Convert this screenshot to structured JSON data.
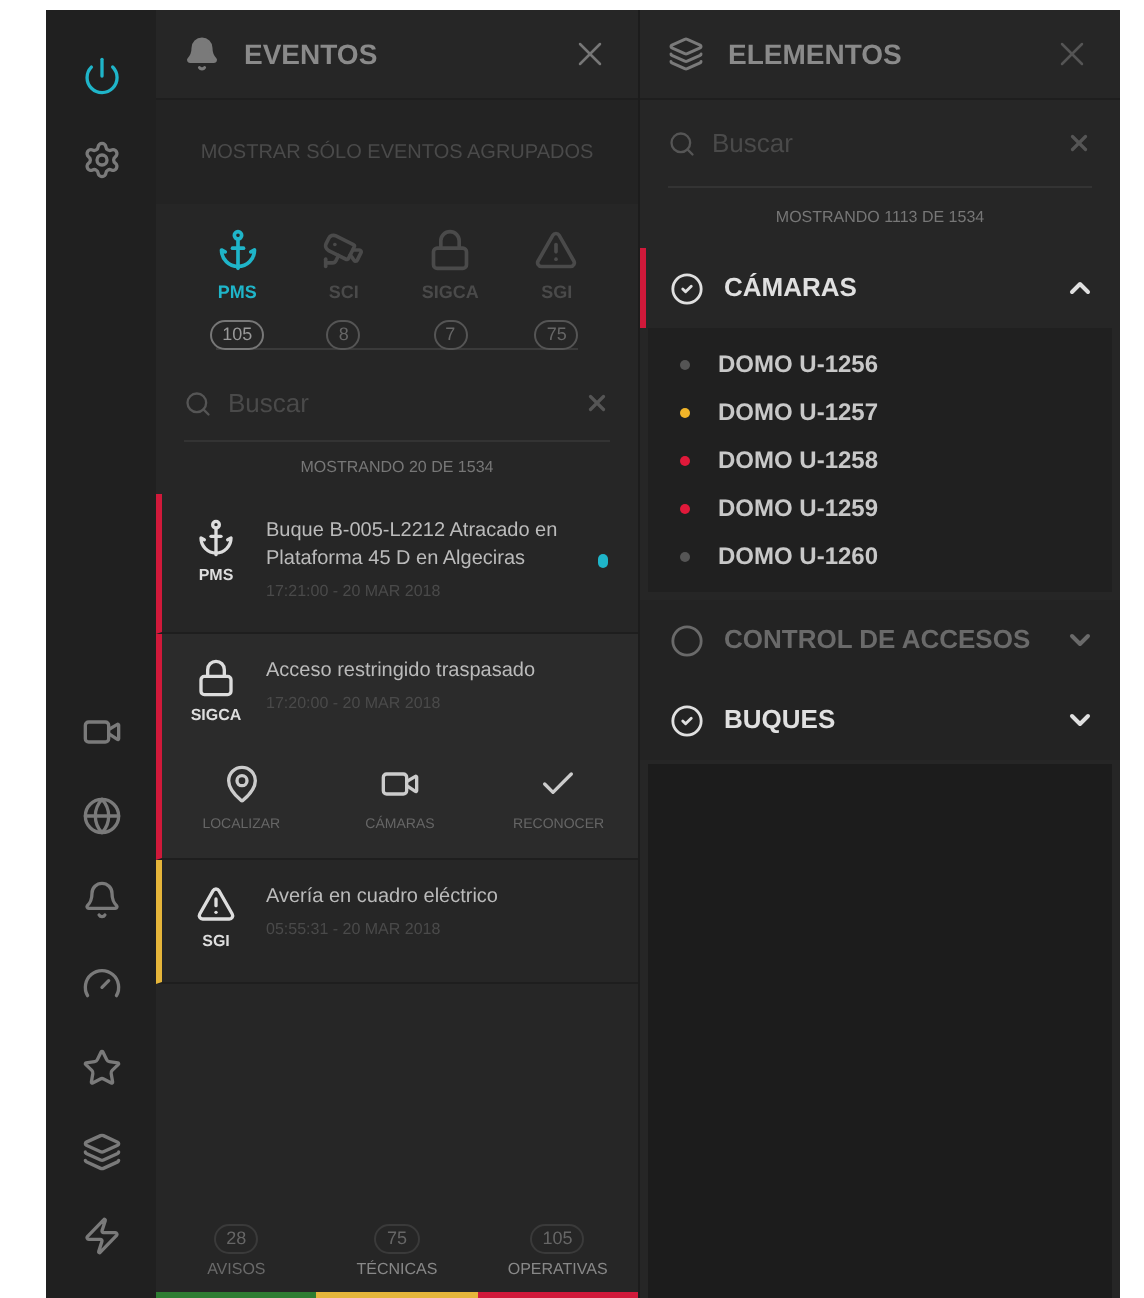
{
  "sidebar": {
    "top_items": [
      {
        "selected": true
      },
      {
        "selected": false
      }
    ],
    "bottom_items": [
      {
        "selected": false
      },
      {
        "selected": false
      },
      {
        "selected": false
      },
      {
        "selected": false
      },
      {
        "selected": false
      },
      {
        "selected": false
      },
      {
        "selected": false
      }
    ]
  },
  "events_panel": {
    "title": "EVENTOS",
    "group_toggle": "MOSTRAR SÓLO EVENTOS AGRUPADOS",
    "filters": [
      {
        "label": "PMS",
        "count": "105",
        "selected": true
      },
      {
        "label": "SCI",
        "count": "8",
        "selected": false
      },
      {
        "label": "SIGCA",
        "count": "7",
        "selected": false
      },
      {
        "label": "SGI",
        "count": "75",
        "selected": false
      }
    ],
    "search": {
      "placeholder": "Buscar"
    },
    "showing": "MOSTRANDO 20 DE 1534",
    "events": [
      {
        "source": "PMS",
        "title": "Buque B-005-L2212 Atracado en Plataforma 45 D en Algeciras",
        "time": "17:21:00 - 20 MAR 2018",
        "color": "#d0193a",
        "unread": true,
        "expanded": false
      },
      {
        "source": "SIGCA",
        "title": "Acceso restringido traspasado",
        "time": "17:20:00 - 20 MAR 2018",
        "color": "#d0193a",
        "unread": false,
        "expanded": true,
        "actions": [
          "LOCALIZAR",
          "CÁMARAS",
          "RECONOCER"
        ]
      },
      {
        "source": "SGI",
        "title": "Avería en cuadro eléctrico",
        "time": "05:55:31 - 20 MAR 2018",
        "color": "#e5b53a",
        "unread": false,
        "expanded": false
      }
    ],
    "footer": [
      {
        "count": "28",
        "label": "AVISOS",
        "color": "#2e7d32",
        "selected": false
      },
      {
        "count": "75",
        "label": "TÉCNICAS",
        "color": "#e5b53a",
        "selected": true
      },
      {
        "count": "105",
        "label": "OPERATIVAS",
        "color": "#d0193a",
        "selected": true
      }
    ]
  },
  "elements_panel": {
    "title": "ELEMENTOS",
    "search": {
      "placeholder": "Buscar"
    },
    "showing": "MOSTRANDO 1113 DE 1534",
    "groups": [
      {
        "name": "CÁMARAS",
        "checked": true,
        "expanded": true,
        "items": [
          {
            "name": "DOMO U-1256",
            "color": "#555555"
          },
          {
            "name": "DOMO U-1257",
            "color": "#f0b429"
          },
          {
            "name": "DOMO U-1258",
            "color": "#e0193a"
          },
          {
            "name": "DOMO U-1259",
            "color": "#e0193a"
          },
          {
            "name": "DOMO U-1260",
            "color": "#555555"
          }
        ]
      },
      {
        "name": "CONTROL DE ACCESOS",
        "checked": false,
        "expanded": false
      },
      {
        "name": "BUQUES",
        "checked": true,
        "expanded": false
      }
    ]
  }
}
